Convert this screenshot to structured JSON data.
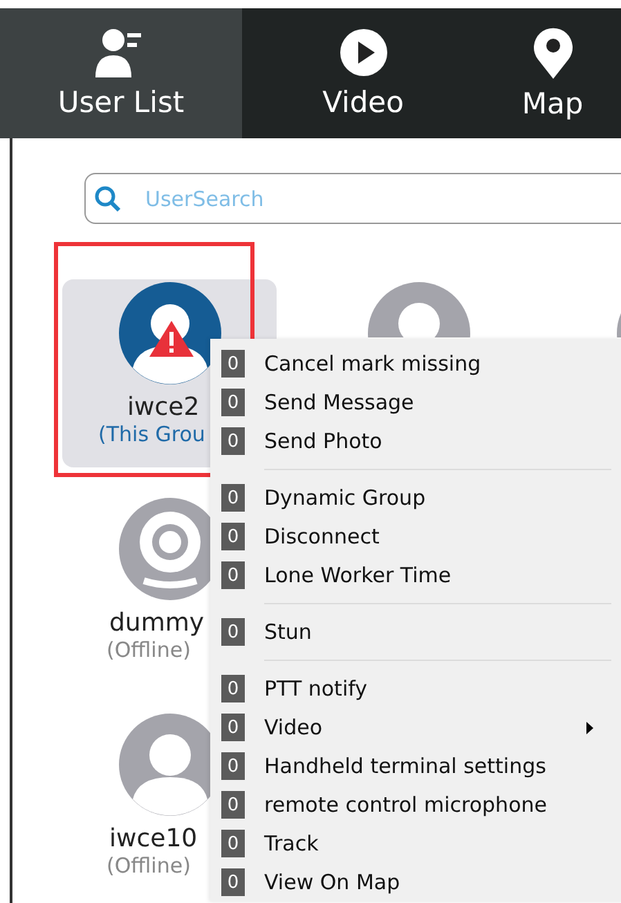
{
  "tabs": [
    {
      "label": "User List",
      "selected": true
    },
    {
      "label": "Video",
      "selected": false
    },
    {
      "label": "Map",
      "selected": false
    }
  ],
  "search": {
    "placeholder": "UserSearch"
  },
  "user_rows": [
    [
      {
        "kind": "alert",
        "name": "iwce2",
        "status": "(This Grou",
        "online": true,
        "selected": true
      },
      {
        "kind": "person",
        "online": false,
        "selected": false
      },
      {
        "kind": "person",
        "online": false,
        "selected": false
      }
    ],
    [
      {
        "kind": "camera",
        "name": "dummy",
        "status": "(Offline)",
        "online": false,
        "selected": false
      }
    ],
    [
      {
        "kind": "person",
        "name": "iwce10",
        "status": "(Offline)",
        "online": false,
        "selected": false
      }
    ]
  ],
  "context_menu": {
    "groups": [
      [
        {
          "badge": "0",
          "label": "Cancel mark missing"
        },
        {
          "badge": "0",
          "label": "Send Message"
        },
        {
          "badge": "0",
          "label": "Send Photo"
        }
      ],
      [
        {
          "badge": "0",
          "label": "Dynamic Group"
        },
        {
          "badge": "0",
          "label": "Disconnect"
        },
        {
          "badge": "0",
          "label": "Lone Worker Time"
        }
      ],
      [
        {
          "badge": "0",
          "label": "Stun"
        }
      ],
      [
        {
          "badge": "0",
          "label": "PTT notify"
        },
        {
          "badge": "0",
          "label": "Video",
          "submenu": true
        },
        {
          "badge": "0",
          "label": "Handheld terminal settings"
        },
        {
          "badge": "0",
          "label": "remote control microphone"
        },
        {
          "badge": "0",
          "label": "Track"
        },
        {
          "badge": "0",
          "label": "View On Map"
        }
      ]
    ]
  }
}
